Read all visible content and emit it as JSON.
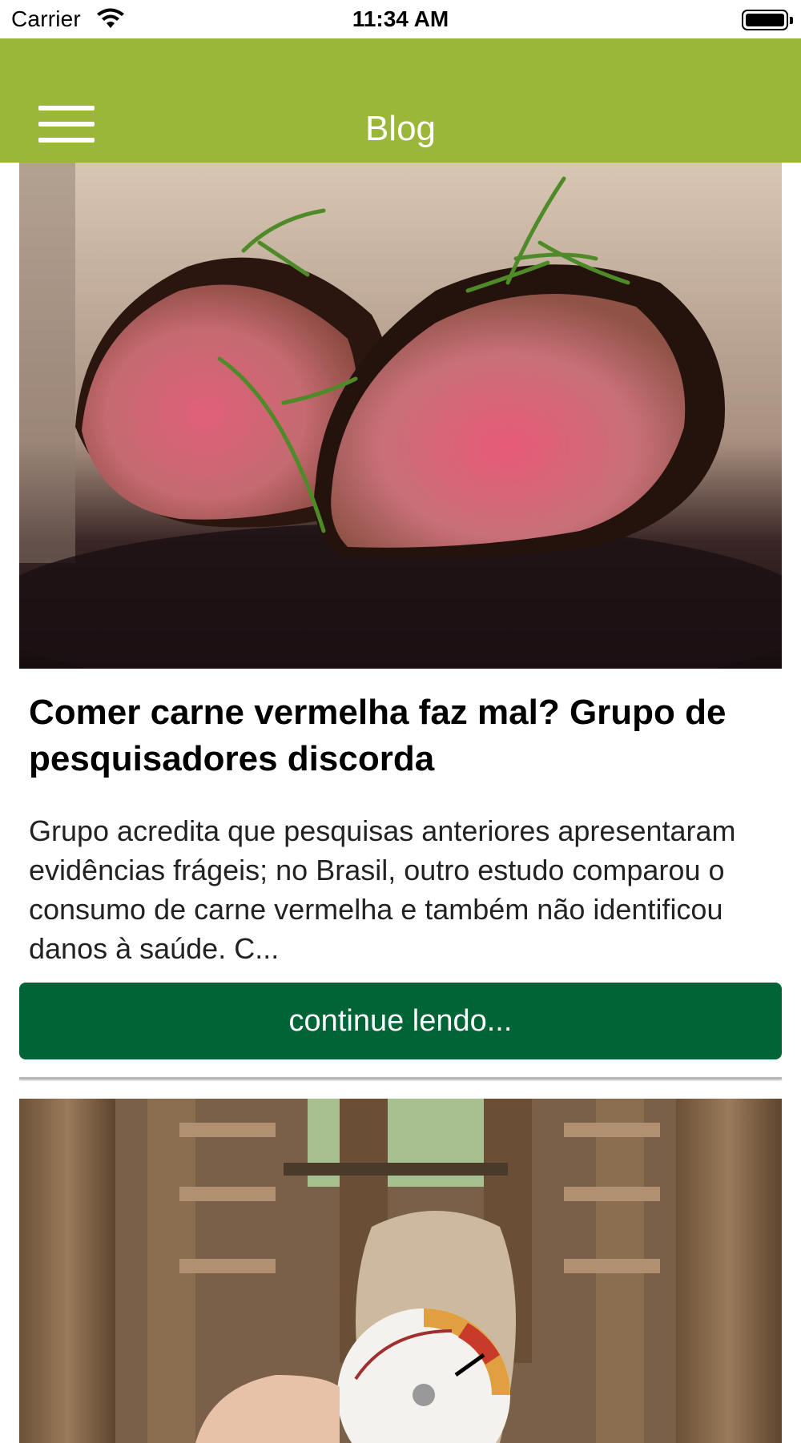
{
  "status_bar": {
    "carrier": "Carrier",
    "time": "11:34 AM",
    "icons": [
      "wifi-icon",
      "battery-icon"
    ]
  },
  "navbar": {
    "title": "Blog",
    "background_color": "#9bb73a",
    "menu_icon": "hamburger-menu-icon"
  },
  "posts": [
    {
      "image": "photo of two pieces of rare roast beef with rosemary on a dark slate",
      "title": "Comer carne vermelha faz mal? Grupo de pesquisadores discorda",
      "excerpt": "Grupo acredita que pesquisas anteriores apresentaram evidências frágeis; no Brasil, outro estudo comparou o consumo de carne vermelha e também não identificou danos à saúde. C...",
      "button_label": "continue lendo...",
      "button_color": "#006437"
    },
    {
      "image": "photo of a cattle chute with wooden rails and a hand holding a round measuring disc"
    }
  ]
}
